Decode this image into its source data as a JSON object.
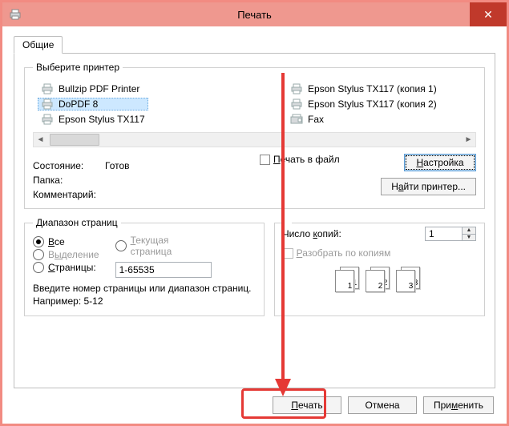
{
  "window": {
    "title": "Печать"
  },
  "tab": {
    "label": "Общие"
  },
  "printer_group": {
    "legend": "Выберите принтер",
    "col1": [
      "Bullzip PDF Printer",
      "DoPDF 8",
      "Epson Stylus TX117"
    ],
    "col2": [
      "Epson Stylus TX117 (копия 1)",
      "Epson Stylus TX117 (копия 2)",
      "Fax"
    ],
    "selected": "DoPDF 8"
  },
  "status": {
    "state_label": "Состояние:",
    "state_value": "Готов",
    "folder_label": "Папка:",
    "comment_label": "Комментарий:",
    "print_to_file": "Печать в файл",
    "settings_btn": "Настройка",
    "find_printer_btn": "Найти принтер..."
  },
  "range_group": {
    "legend": "Диапазон страниц",
    "all": "Все",
    "current": "Текущая страница",
    "selection": "Выделение",
    "pages": "Страницы:",
    "pages_value": "1-65535",
    "hint": "Введите номер страницы или диапазон страниц. Например: 5-12"
  },
  "copies_group": {
    "copies_label": "Число копий:",
    "copies_value": "1",
    "collate": "Разобрать по копиям",
    "stack": [
      "1",
      "2",
      "3"
    ]
  },
  "footer": {
    "print": "Печать",
    "cancel": "Отмена",
    "apply": "Применить"
  }
}
